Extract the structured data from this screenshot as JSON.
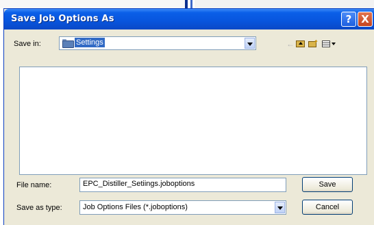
{
  "dialog": {
    "title": "Save Job Options As",
    "help_label": "?",
    "close_label": "X"
  },
  "toolbar": {
    "save_in_label": "Save in:",
    "save_in_value": "Settings",
    "back_icon": "back-arrow-icon",
    "up_icon": "up-one-level-icon",
    "new_folder_icon": "new-folder-icon",
    "views_icon": "views-menu-icon"
  },
  "file_list": {
    "items": []
  },
  "form": {
    "file_name_label": "File name:",
    "file_name_value": "EPC_Distiller_Setiings.joboptions",
    "save_as_type_label": "Save as type:",
    "save_as_type_value": "Job Options Files (*.joboptions)"
  },
  "buttons": {
    "save": "Save",
    "cancel": "Cancel"
  },
  "colors": {
    "titlebar": "#0a5fe8",
    "selection": "#316ac5",
    "close_button": "#c3431f"
  }
}
